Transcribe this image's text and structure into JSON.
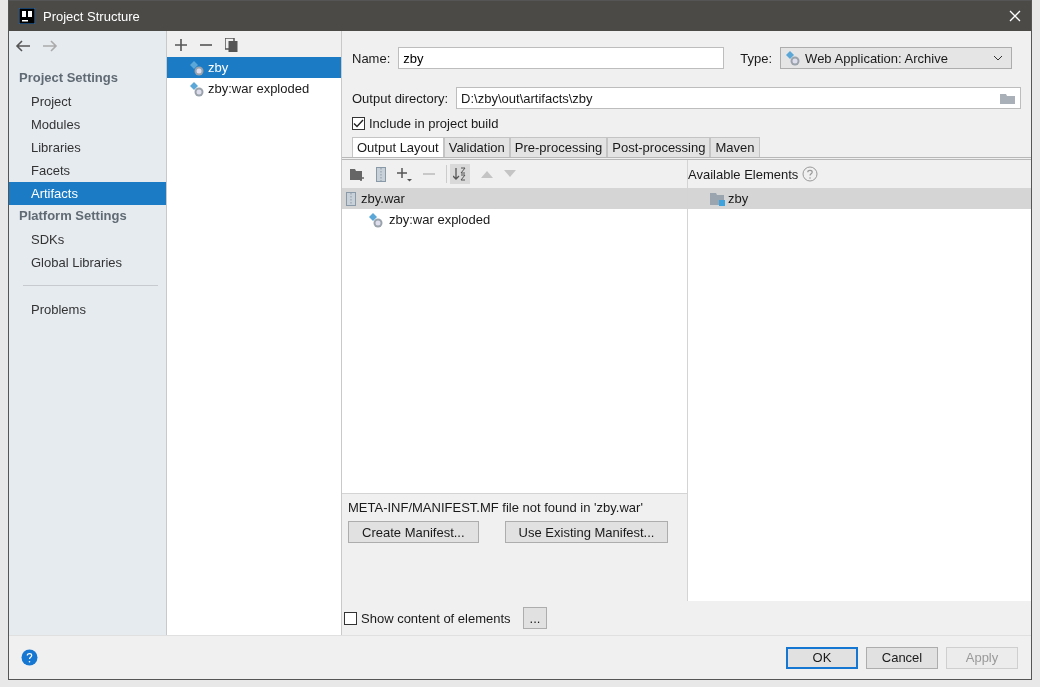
{
  "window": {
    "title": "Project Structure"
  },
  "sidebar": {
    "groups": [
      {
        "title": "Project Settings",
        "items": [
          {
            "label": "Project",
            "selected": false
          },
          {
            "label": "Modules",
            "selected": false
          },
          {
            "label": "Libraries",
            "selected": false
          },
          {
            "label": "Facets",
            "selected": false
          },
          {
            "label": "Artifacts",
            "selected": true
          }
        ]
      },
      {
        "title": "Platform Settings",
        "items": [
          {
            "label": "SDKs",
            "selected": false
          },
          {
            "label": "Global Libraries",
            "selected": false
          }
        ]
      }
    ],
    "extra_items": [
      {
        "label": "Problems",
        "selected": false
      }
    ]
  },
  "artifacts": [
    {
      "label": "zby",
      "selected": true
    },
    {
      "label": "zby:war exploded",
      "selected": false
    }
  ],
  "name_field": {
    "label": "Name:",
    "value": "zby"
  },
  "type_field": {
    "label": "Type:",
    "value": "Web Application: Archive"
  },
  "output_field": {
    "label": "Output directory:",
    "value": "D:\\zby\\out\\artifacts\\zby"
  },
  "include_in_build": {
    "label": "Include in project build",
    "checked": true
  },
  "tabs": [
    {
      "label": "Output Layout",
      "selected": true
    },
    {
      "label": "Validation",
      "selected": false
    },
    {
      "label": "Pre-processing",
      "selected": false
    },
    {
      "label": "Post-processing",
      "selected": false
    },
    {
      "label": "Maven",
      "selected": false
    }
  ],
  "layout_tree": [
    {
      "label": "zby.war",
      "selected": true,
      "kind": "archive",
      "children": [
        {
          "label": "zby:war exploded",
          "selected": false,
          "kind": "artifact"
        }
      ]
    }
  ],
  "available": {
    "title": "Available Elements",
    "items": [
      {
        "label": "zby",
        "selected": true
      }
    ]
  },
  "manifest": {
    "message": "META-INF/MANIFEST.MF file not found in 'zby.war'",
    "buttons": [
      "Create Manifest...",
      "Use Existing Manifest..."
    ]
  },
  "show_content": {
    "label": "Show content of elements",
    "checked": false,
    "button": "..."
  },
  "footer": {
    "buttons": [
      {
        "label": "OK",
        "kind": "default",
        "disabled": false
      },
      {
        "label": "Cancel",
        "kind": "normal",
        "disabled": false
      },
      {
        "label": "Apply",
        "kind": "normal",
        "disabled": true
      }
    ]
  }
}
